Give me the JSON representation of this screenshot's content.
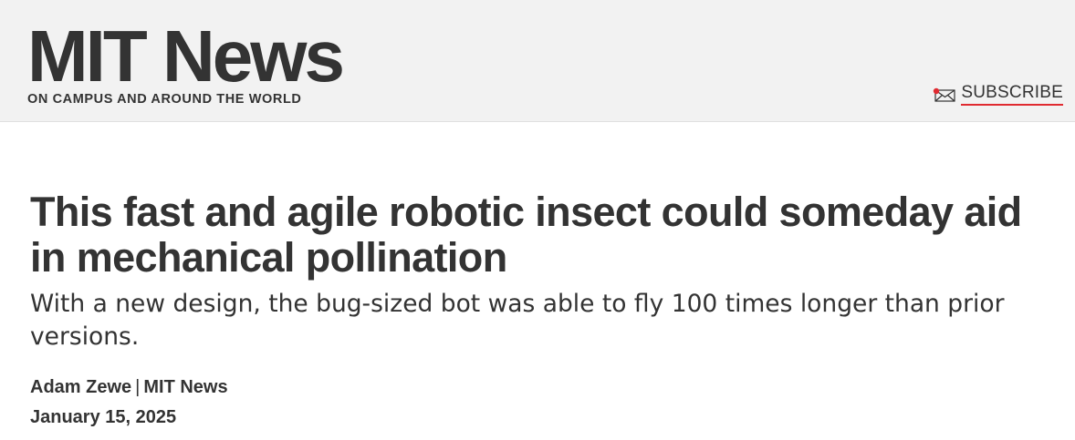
{
  "header": {
    "brand_title": "MIT News",
    "brand_tagline": "ON CAMPUS AND AROUND THE WORLD",
    "subscribe_label": "SUBSCRIBE",
    "subscribe_icon": "mail-icon"
  },
  "article": {
    "headline": "This fast and agile robotic insect could someday aid in mechanical pollination",
    "dek": "With a new design, the bug-sized bot was able to fly 100 times longer than prior versions.",
    "author": "Adam Zewe",
    "byline_separator": "|",
    "source": "MIT News",
    "date": "January 15, 2025"
  },
  "colors": {
    "header_background": "#f2f2f2",
    "text": "#333333",
    "accent_red": "#e02b31"
  }
}
